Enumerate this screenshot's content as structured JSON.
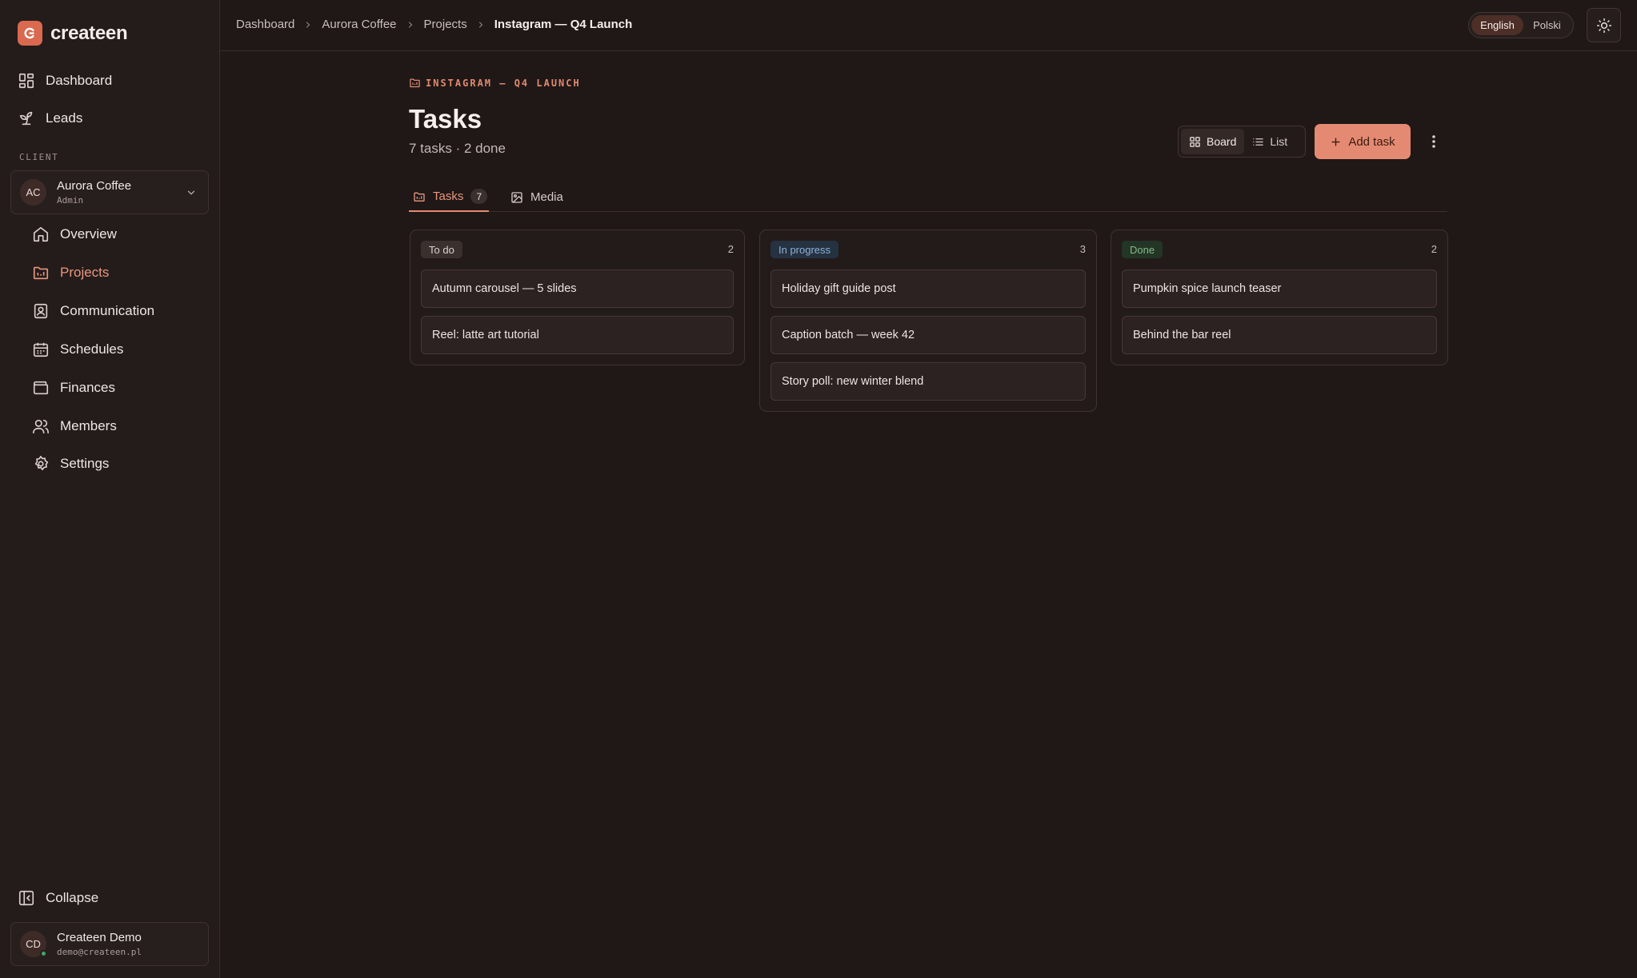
{
  "app": {
    "name": "createen"
  },
  "sidebar": {
    "top_items": [
      {
        "label": "Dashboard",
        "icon": "dashboard-grid-icon"
      },
      {
        "label": "Leads",
        "icon": "sprout-icon"
      }
    ],
    "section_label": "CLIENT",
    "client": {
      "initials": "AC",
      "name": "Aurora Coffee",
      "role": "Admin"
    },
    "client_items": [
      {
        "label": "Overview",
        "icon": "home-icon",
        "active": false
      },
      {
        "label": "Projects",
        "icon": "folder-icon",
        "active": true
      },
      {
        "label": "Communication",
        "icon": "contact-card-icon",
        "active": false
      },
      {
        "label": "Schedules",
        "icon": "calendar-icon",
        "active": false
      },
      {
        "label": "Finances",
        "icon": "wallet-icon",
        "active": false
      },
      {
        "label": "Members",
        "icon": "users-icon",
        "active": false
      },
      {
        "label": "Settings",
        "icon": "gear-icon",
        "active": false
      }
    ],
    "collapse_label": "Collapse",
    "user": {
      "initials": "CD",
      "name": "Createen Demo",
      "email": "demo@createen.pl",
      "status": "online"
    }
  },
  "topbar": {
    "breadcrumb": [
      "Dashboard",
      "Aurora Coffee",
      "Projects",
      "Instagram — Q4 Launch"
    ],
    "languages": [
      {
        "label": "English",
        "active": true
      },
      {
        "label": "Polski",
        "active": false
      }
    ],
    "theme_icon": "sun-icon"
  },
  "main": {
    "eyebrow": "INSTAGRAM — Q4 LAUNCH",
    "title": "Tasks",
    "subtitle": "7 tasks · 2 done",
    "view_options": [
      {
        "label": "Board",
        "active": true
      },
      {
        "label": "List",
        "active": false
      }
    ],
    "add_label": "Add task",
    "tabs": [
      {
        "label": "Tasks",
        "count": "7",
        "active": true
      },
      {
        "label": "Media",
        "count": null,
        "active": false
      }
    ],
    "columns": [
      {
        "label": "To do",
        "count": "2",
        "cards": [
          "Autumn carousel — 5 slides",
          "Reel: latte art tutorial"
        ]
      },
      {
        "label": "In progress",
        "count": "3",
        "cards": [
          "Holiday gift guide post",
          "Caption batch — week 42",
          "Story poll: new winter blend"
        ]
      },
      {
        "label": "Done",
        "count": "2",
        "cards": [
          "Pumpkin spice launch teaser",
          "Behind the bar reel"
        ]
      }
    ]
  },
  "colors": {
    "background": "#1f1817",
    "sidebar": "#241c1b",
    "accent": "#e58a72",
    "accent_text": "#e9967e",
    "status_todo": "#3a302e",
    "status_in_progress": "#253241",
    "status_done": "#233525"
  }
}
